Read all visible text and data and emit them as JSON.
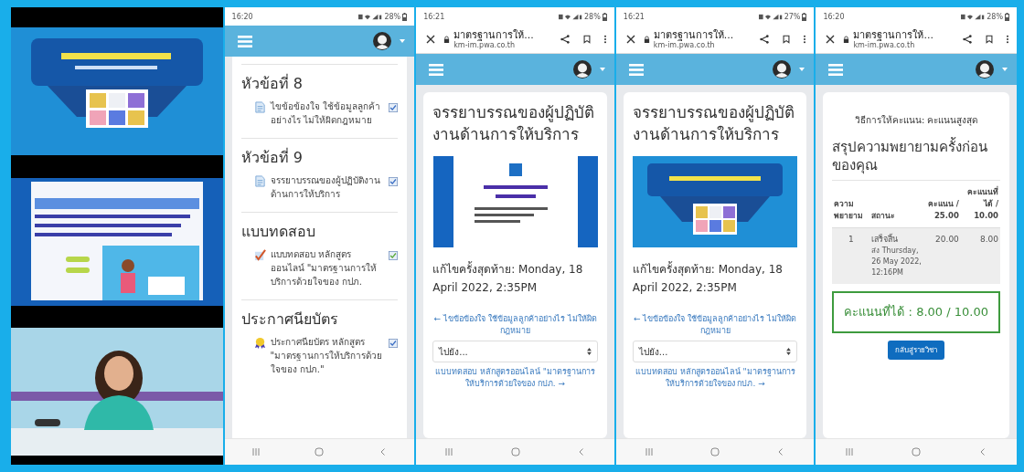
{
  "phones": [
    {
      "kind": "video"
    },
    {
      "kind": "course",
      "status": {
        "time": "16:20",
        "battery": "28%"
      },
      "sections": [
        {
          "title": "หัวข้อที่ 8",
          "activities": [
            {
              "kind": "page",
              "name": "ไขข้อข้องใจ ใช้ข้อมูลลูกค้าอย่างไร ไม่ให้ผิดกฎหมาย",
              "checked": true
            }
          ]
        },
        {
          "title": "หัวข้อที่ 9",
          "activities": [
            {
              "kind": "page",
              "name": "จรรยาบรรณของผู้ปฏิบัติงานด้านการให้บริการ",
              "checked": true
            }
          ]
        },
        {
          "title": "แบบทดสอบ",
          "activities": [
            {
              "kind": "quiz",
              "name": "แบบทดสอบ หลักสูตรออนไลน์ \"มาตรฐานการให้บริการด้วยใจของ กปภ.",
              "checked": true
            }
          ]
        },
        {
          "title": "ประกาศนียบัตร",
          "activities": [
            {
              "kind": "certificate",
              "name": "ประกาศนียบัตร หลักสูตร \"มาตรฐานการให้บริการด้วยใจของ กปภ.\"",
              "checked": true
            }
          ]
        }
      ]
    },
    {
      "kind": "page",
      "status": {
        "time": "16:21",
        "battery": "28%"
      },
      "browser": {
        "title": "มาตรฐานการให้...",
        "url": "km-im.pwa.co.th"
      },
      "heading": "จรรยาบรรณของผู้ปฏิบัติงานด้านการให้บริการ",
      "modified": "แก้ไขครั้งสุดท้าย: Monday, 18 April 2022, 2:35PM",
      "prev_link": "← ไขข้อข้องใจ ใช้ข้อมูลลูกค้าอย่างไร ไม่ให้ผิดกฎหมาย",
      "jump_select": "ไปยัง...",
      "next_link": "แบบทดสอบ หลักสูตรออนไลน์ \"มาตรฐานการให้บริการด้วยใจของ กปภ. →"
    },
    {
      "kind": "page",
      "status": {
        "time": "16:21",
        "battery": "27%"
      },
      "browser": {
        "title": "มาตรฐานการให้...",
        "url": "km-im.pwa.co.th"
      },
      "heading": "จรรยาบรรณของผู้ปฏิบัติงานด้านการให้บริการ",
      "modified": "แก้ไขครั้งสุดท้าย: Monday, 18 April 2022, 2:35PM",
      "prev_link": "← ไขข้อข้องใจ ใช้ข้อมูลลูกค้าอย่างไร ไม่ให้ผิดกฎหมาย",
      "jump_select": "ไปยัง...",
      "next_link": "แบบทดสอบ หลักสูตรออนไลน์ \"มาตรฐานการให้บริการด้วยใจของ กปภ. →"
    },
    {
      "kind": "quiz_result",
      "status": {
        "time": "16:20",
        "battery": "28%"
      },
      "browser": {
        "title": "มาตรฐานการให้...",
        "url": "km-im.pwa.co.th"
      },
      "grading_method": "วิธีการให้คะแนน: คะแนนสูงสุด",
      "summary_title": "สรุปความพยายามครั้งก่อนของคุณ",
      "table": {
        "columns": [
          "ความพยายาม",
          "สถานะ",
          "คะแนน / 25.00",
          "คะแนนที่ได้ / 10.00"
        ],
        "rows": [
          {
            "attempt": "1",
            "state": "เสร็จสิ้น",
            "submitted": "ส่ง Thursday, 26 May 2022, 12:16PM",
            "marks": "20.00",
            "grade": "8.00"
          }
        ]
      },
      "final_grade": "คะแนนที่ได้ : 8.00 / 10.00",
      "back_button": "กลับสู่รายวิชา"
    }
  ]
}
